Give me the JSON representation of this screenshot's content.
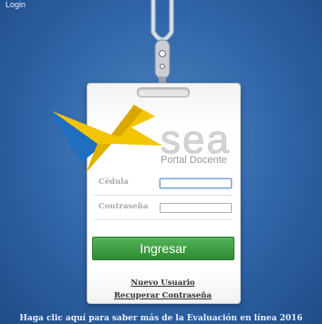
{
  "window": {
    "title": "Login"
  },
  "logo": {
    "text": "sea",
    "subtitle": "Portal Docente"
  },
  "form": {
    "cedula_label": "Cédula",
    "cedula_value": "",
    "password_label": "Contraseña",
    "password_value": "",
    "submit_label": "Ingresar"
  },
  "links": {
    "new_user": "Nuevo Usuario",
    "recover_password": "Recuperar Contraseña",
    "evaluation_info": "Haga clic aquí para saber más de la Evaluación en línea 2016"
  },
  "colors": {
    "background": "#2f64a6",
    "button": "#3c9c40",
    "logo_yellow": "#f2c500",
    "logo_blue": "#1f6fc0"
  }
}
